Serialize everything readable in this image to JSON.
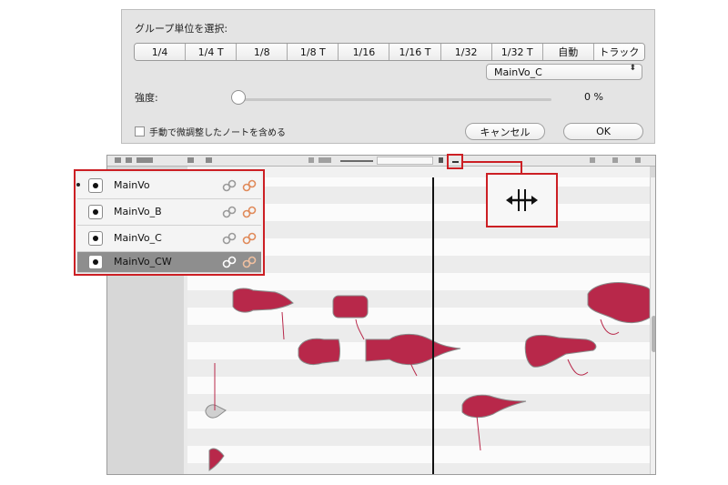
{
  "dialog": {
    "title": "グループ単位を選択:",
    "segments": [
      "1/4",
      "1/4 T",
      "1/8",
      "1/8 T",
      "1/16",
      "1/16 T",
      "1/32",
      "1/32 T",
      "自動",
      "トラック"
    ],
    "selected_segment": "トラック",
    "track_popup": {
      "value": "MainVo_C",
      "arrow": "⬍"
    },
    "strength_label": "強度:",
    "strength_value": "0 %",
    "strength_fraction": 0,
    "manual_checkbox": {
      "label": "手動で微調整したノートを含める",
      "checked": false
    },
    "cancel_label": "キャンセル",
    "ok_label": "OK"
  },
  "tracks": [
    {
      "name": "MainVo",
      "active": true,
      "selected": false
    },
    {
      "name": "MainVo_B",
      "active": false,
      "selected": false
    },
    {
      "name": "MainVo_C",
      "active": false,
      "selected": false
    },
    {
      "name": "MainVo_CW",
      "active": false,
      "selected": true
    }
  ],
  "icons": {
    "link_gray": "link-chain-gray-icon",
    "link_orange": "link-chain-orange-icon",
    "record_dot": "record-dot-icon",
    "group_tool": "group-handle-icon"
  },
  "colors": {
    "highlight": "#cc1f24",
    "note_fill": "#b8284a",
    "note_fill_light": "#d0506a",
    "note_gray": "#9a9a9a"
  }
}
